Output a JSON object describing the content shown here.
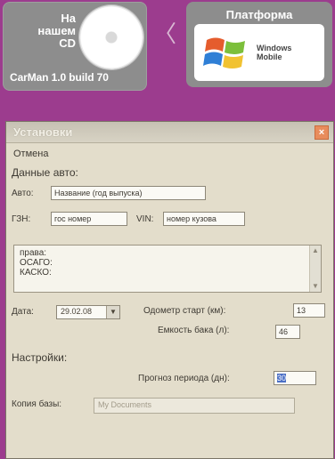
{
  "cd_badge": {
    "line1": "На",
    "line2": "нашем",
    "line3": "CD",
    "version": "CarMan 1.0 build 70"
  },
  "separator_glyph": "〈",
  "platform_badge": {
    "title": "Платформа",
    "logo_line1": "Windows",
    "logo_line2": "Mobile",
    "logo_icon": "windows-flag-icon"
  },
  "window": {
    "title": "Установки",
    "close_glyph": "×",
    "cancel_menu": "Отмена",
    "car_section": "Данные авто:",
    "auto_label": "Авто:",
    "auto_value": "Название (год выпуска)",
    "gnz_label": "ГЗН:",
    "gnz_value": "гос номер",
    "vin_label": "VIN:",
    "vin_value": "номер кузова",
    "memo_text": "права:\nОСАГО:\nКАСКО:",
    "date_label": "Дата:",
    "date_value": "29.02.08",
    "odometer_label": "Одометр старт (км):",
    "odometer_value": "13",
    "tank_label": "Емкость бака (л):",
    "tank_value": "46",
    "settings_section": "Настройки:",
    "forecast_label": "Прогноз периода (дн):",
    "forecast_value": "30",
    "backup_label": "Копия базы:",
    "backup_value": "My Documents"
  },
  "colors": {
    "background": "#9c3c8e",
    "badge": "#8d8d8d",
    "dialog": "#e3ddcb",
    "selection": "#4b6fc5"
  }
}
